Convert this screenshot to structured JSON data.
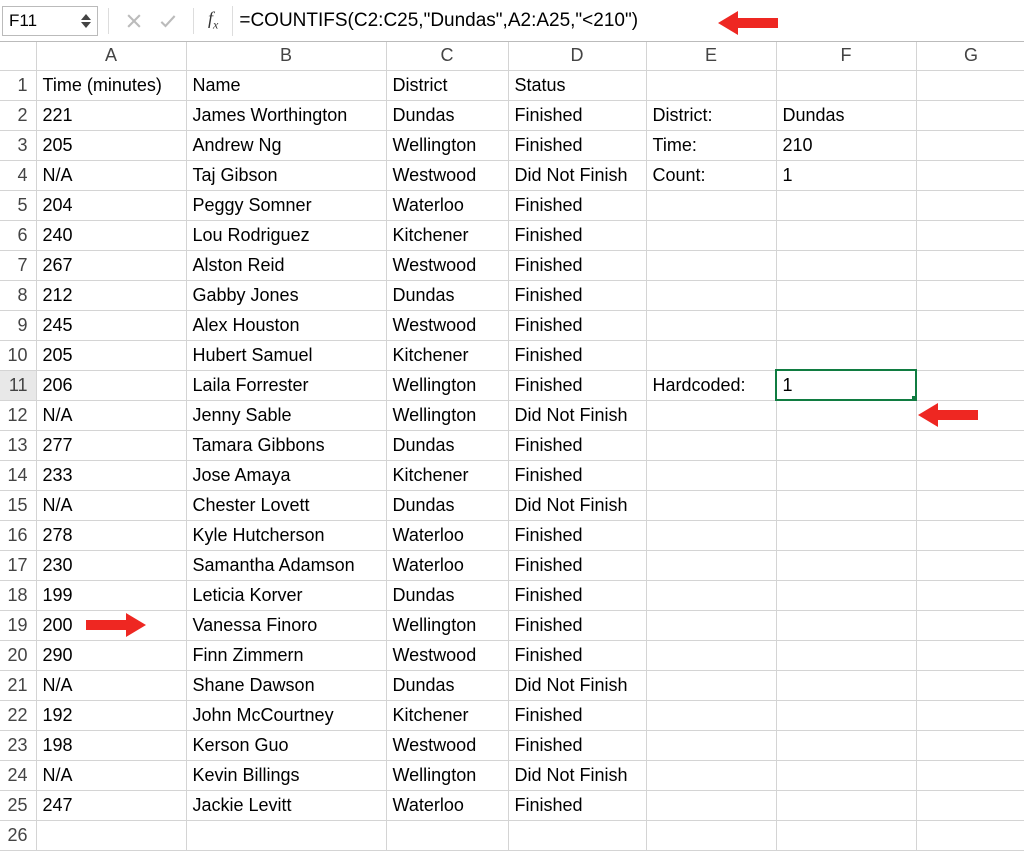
{
  "namebox": "F11",
  "formula": "=COUNTIFS(C2:C25,\"Dundas\",A2:A25,\"<210\")",
  "fx_label_f": "f",
  "fx_label_x": "x",
  "columns": [
    "A",
    "B",
    "C",
    "D",
    "E",
    "F",
    "G"
  ],
  "headers": {
    "A": "Time (minutes)",
    "B": "Name",
    "C": "District",
    "D": "Status"
  },
  "side_labels": {
    "district": "District:",
    "time": "Time:",
    "count": "Count:",
    "hardcoded": "Hardcoded:"
  },
  "side_values": {
    "district": "Dundas",
    "time": "210",
    "count": "1",
    "hardcoded": "1"
  },
  "rows": [
    {
      "n": 1
    },
    {
      "n": 2,
      "A": "221",
      "B": "James Worthington",
      "C": "Dundas",
      "D": "Finished"
    },
    {
      "n": 3,
      "A": "205",
      "B": "Andrew Ng",
      "C": "Wellington",
      "D": "Finished"
    },
    {
      "n": 4,
      "A": "N/A",
      "B": "Taj Gibson",
      "C": "Westwood",
      "D": "Did Not Finish"
    },
    {
      "n": 5,
      "A": "204",
      "B": "Peggy Somner",
      "C": "Waterloo",
      "D": "Finished"
    },
    {
      "n": 6,
      "A": "240",
      "B": "Lou Rodriguez",
      "C": "Kitchener",
      "D": "Finished"
    },
    {
      "n": 7,
      "A": "267",
      "B": "Alston Reid",
      "C": "Westwood",
      "D": "Finished"
    },
    {
      "n": 8,
      "A": "212",
      "B": "Gabby Jones",
      "C": "Dundas",
      "D": "Finished"
    },
    {
      "n": 9,
      "A": "245",
      "B": "Alex Houston",
      "C": "Westwood",
      "D": "Finished"
    },
    {
      "n": 10,
      "A": "205",
      "B": "Hubert Samuel",
      "C": "Kitchener",
      "D": "Finished"
    },
    {
      "n": 11,
      "A": "206",
      "B": "Laila Forrester",
      "C": "Wellington",
      "D": "Finished"
    },
    {
      "n": 12,
      "A": "N/A",
      "B": "Jenny Sable",
      "C": "Wellington",
      "D": "Did Not Finish"
    },
    {
      "n": 13,
      "A": "277",
      "B": "Tamara Gibbons",
      "C": "Dundas",
      "D": "Finished"
    },
    {
      "n": 14,
      "A": "233",
      "B": "Jose Amaya",
      "C": "Kitchener",
      "D": "Finished"
    },
    {
      "n": 15,
      "A": "N/A",
      "B": "Chester Lovett",
      "C": "Dundas",
      "D": "Did Not Finish"
    },
    {
      "n": 16,
      "A": "278",
      "B": "Kyle Hutcherson",
      "C": "Waterloo",
      "D": "Finished"
    },
    {
      "n": 17,
      "A": "230",
      "B": "Samantha Adamson",
      "C": "Waterloo",
      "D": "Finished"
    },
    {
      "n": 18,
      "A": "199",
      "B": "Leticia Korver",
      "C": "Dundas",
      "D": "Finished"
    },
    {
      "n": 19,
      "A": "200",
      "B": "Vanessa Finoro",
      "C": "Wellington",
      "D": "Finished"
    },
    {
      "n": 20,
      "A": "290",
      "B": "Finn Zimmern",
      "C": "Westwood",
      "D": "Finished"
    },
    {
      "n": 21,
      "A": "N/A",
      "B": "Shane Dawson",
      "C": "Dundas",
      "D": "Did Not Finish"
    },
    {
      "n": 22,
      "A": "192",
      "B": "John McCourtney",
      "C": "Kitchener",
      "D": "Finished"
    },
    {
      "n": 23,
      "A": "198",
      "B": "Kerson Guo",
      "C": "Westwood",
      "D": "Finished"
    },
    {
      "n": 24,
      "A": "N/A",
      "B": "Kevin Billings",
      "C": "Wellington",
      "D": "Did Not Finish"
    },
    {
      "n": 25,
      "A": "247",
      "B": "Jackie Levitt",
      "C": "Waterloo",
      "D": "Finished"
    },
    {
      "n": 26
    }
  ]
}
